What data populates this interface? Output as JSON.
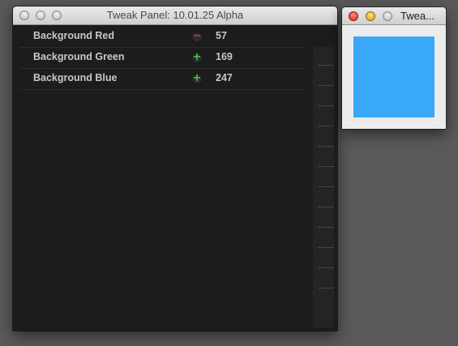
{
  "panel": {
    "title": "Tweak Panel: 10.01.25 Alpha",
    "params": [
      {
        "label": "Background Red",
        "action": "−",
        "value": "57"
      },
      {
        "label": "Background Green",
        "action": "+",
        "value": "169"
      },
      {
        "label": "Background Blue",
        "action": "+",
        "value": "247"
      }
    ]
  },
  "preview": {
    "title": "Twea...",
    "swatch_color": "#39a9f7"
  }
}
